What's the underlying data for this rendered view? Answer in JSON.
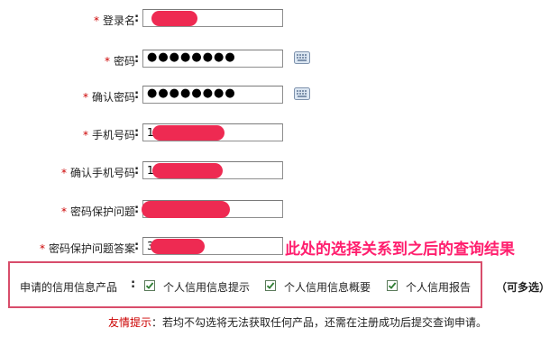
{
  "form": {
    "required_mark": "*",
    "colon": ":",
    "fields": [
      {
        "label": "登录名",
        "value": ""
      },
      {
        "label": "密码",
        "value": "●●●●●●●●"
      },
      {
        "label": "确认密码",
        "value": "●●●●●●●●"
      },
      {
        "label": "手机号码",
        "value": "1"
      },
      {
        "label": "确认手机号码",
        "value": "1"
      },
      {
        "label": "密码保护问题",
        "value": ""
      },
      {
        "label": "密码保护问题答案",
        "value": "3"
      }
    ],
    "keyboard_icon": "keyboard-icon"
  },
  "annotation": "此处的选择关系到之后的查询结果",
  "credit_products": {
    "label": "申请的信用信息产品",
    "options": [
      {
        "label": "个人信用信息提示",
        "checked": true
      },
      {
        "label": "个人信用信息概要",
        "checked": true
      },
      {
        "label": "个人信用报告",
        "checked": true
      }
    ],
    "multi_note": "（可多选）"
  },
  "tip": {
    "label": "友情提示",
    "text": "：若均不勾选将无法获取任何产品，还需在注册成功后提交查询申请。"
  },
  "colors": {
    "required": "#cc0000",
    "redaction": "#ee2a52",
    "annotation": "#ff1f6e",
    "highlight_box": "#d84d6b",
    "checkbox_check": "#2e7d32"
  }
}
